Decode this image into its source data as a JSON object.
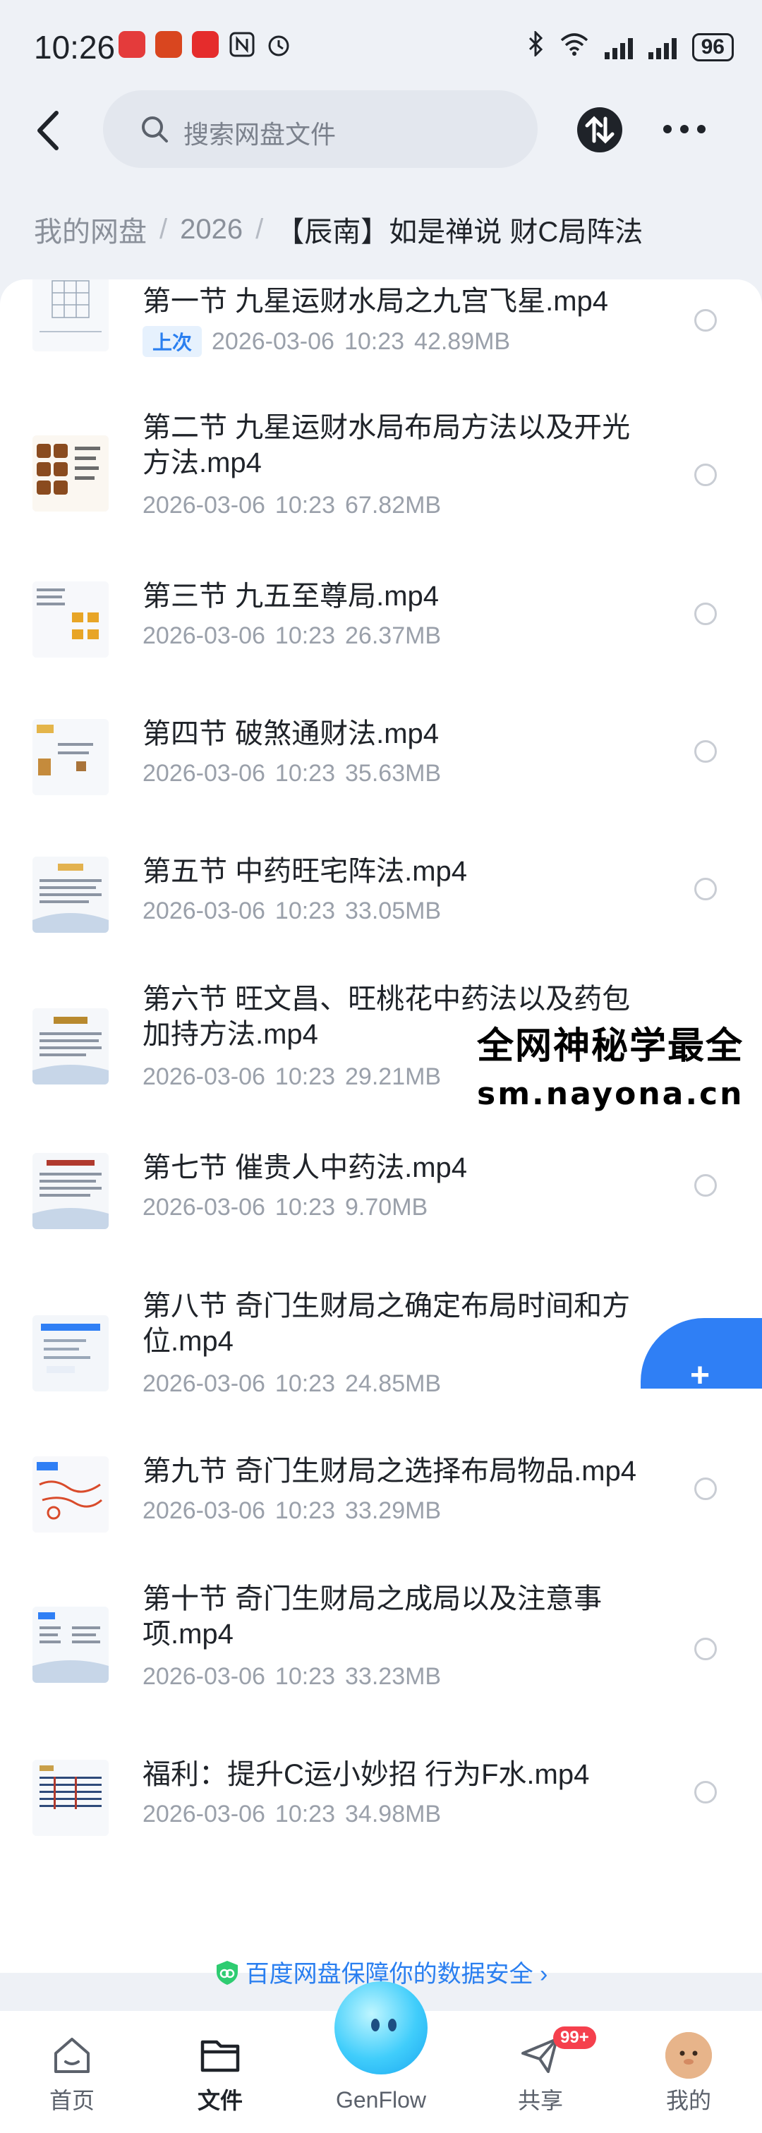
{
  "status_bar": {
    "time": "10:26",
    "battery": "96",
    "app_icons": [
      "huawei-app-icon",
      "game-app-icon",
      "red-app-icon",
      "nfc-icon",
      "alarm-icon"
    ]
  },
  "header": {
    "search_placeholder": "搜索网盘文件"
  },
  "breadcrumb": {
    "root": "我的网盘",
    "sep": "/",
    "folder": "2026",
    "current": "【辰南】如是禅说 财C局阵法"
  },
  "files": [
    {
      "name": "第一节 九星运财水局之九宫飞星.mp4",
      "tag": "上次",
      "date": "2026-03-06",
      "time": "10:23",
      "size": "42.89MB"
    },
    {
      "name": "第二节 九星运财水局布局方法以及开光方法.mp4",
      "date": "2026-03-06",
      "time": "10:23",
      "size": "67.82MB"
    },
    {
      "name": "第三节 九五至尊局.mp4",
      "date": "2026-03-06",
      "time": "10:23",
      "size": "26.37MB"
    },
    {
      "name": "第四节 破煞通财法.mp4",
      "date": "2026-03-06",
      "time": "10:23",
      "size": "35.63MB"
    },
    {
      "name": "第五节 中药旺宅阵法.mp4",
      "date": "2026-03-06",
      "time": "10:23",
      "size": "33.05MB"
    },
    {
      "name": "第六节 旺文昌、旺桃花中药法以及药包加持方法.mp4",
      "date": "2026-03-06",
      "time": "10:23",
      "size": "29.21MB"
    },
    {
      "name": "第七节 催贵人中药法.mp4",
      "date": "2026-03-06",
      "time": "10:23",
      "size": "9.70MB"
    },
    {
      "name": "第八节 奇门生财局之确定布局时间和方位.mp4",
      "date": "2026-03-06",
      "time": "10:23",
      "size": "24.85MB"
    },
    {
      "name": "第九节 奇门生财局之选择布局物品.mp4",
      "date": "2026-03-06",
      "time": "10:23",
      "size": "33.29MB"
    },
    {
      "name": "第十节 奇门生财局之成局以及注意事项.mp4",
      "date": "2026-03-06",
      "time": "10:23",
      "size": "33.23MB"
    },
    {
      "name": "福利：提升C运小妙招 行为F水.mp4",
      "date": "2026-03-06",
      "time": "10:23",
      "size": "34.98MB"
    }
  ],
  "watermark": {
    "line1": "全网神秘学最全",
    "line2": "sm.nayona.cn"
  },
  "fab": {
    "label": "+"
  },
  "security_note": "百度网盘保障你的数据安全 ›",
  "tabs": [
    {
      "label": "首页",
      "icon": "home-icon"
    },
    {
      "label": "文件",
      "icon": "folder-icon",
      "active": true
    },
    {
      "label": "GenFlow",
      "icon": "genflow-orb"
    },
    {
      "label": "共享",
      "icon": "share-icon",
      "badge": "99+"
    },
    {
      "label": "我的",
      "icon": "avatar"
    }
  ],
  "colors": {
    "accent": "#2a7ff0",
    "badge": "#f5404d",
    "background": "#eef1f6"
  }
}
